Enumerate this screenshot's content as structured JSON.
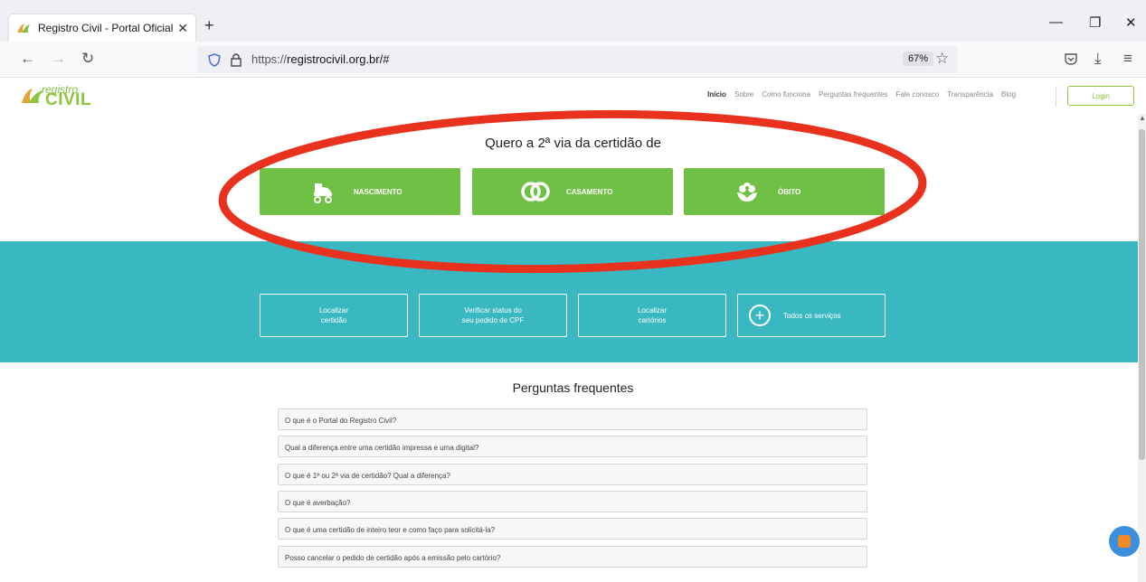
{
  "browser": {
    "tab_title": "Registro Civil - Portal Oficial",
    "tab_close": "✕",
    "new_tab": "+",
    "url_scheme": "https://",
    "url_rest": "registrocivil.org.br/#",
    "zoom": "67%"
  },
  "site": {
    "logo_small": "registro",
    "logo_big": "CIVIL",
    "menu": [
      "Início",
      "Sobre",
      "Como funciona",
      "Perguntas frequentes",
      "Fale conosco",
      "Transparência",
      "Blog"
    ],
    "login": "Login"
  },
  "hero": {
    "title": "Quero a 2ª via da certidão de",
    "buttons": [
      {
        "label": "NASCIMENTO",
        "icon": "stroller-icon"
      },
      {
        "label": "CASAMENTO",
        "icon": "rings-icon"
      },
      {
        "label": "ÓBITO",
        "icon": "flower-icon"
      }
    ]
  },
  "services": [
    {
      "label": "Localizar\ncertidão"
    },
    {
      "label": "Verificar status do\nseu pedido de CPF"
    },
    {
      "label": "Localizar\ncartórios"
    },
    {
      "label": "Todos os serviços",
      "icon": "plus-circle-icon"
    }
  ],
  "faq": {
    "title": "Perguntas frequentes",
    "items": [
      "O que é o Portal do Registro Civil?",
      "Qual a diferença entre uma certidão impressa e uma digital?",
      "O que é 1ª ou 2ª via de certidão? Qual a diferença?",
      "O que é averbação?",
      "O que é uma certidão de inteiro teor e como faço para solicitá-la?",
      "Posso cancelar o pedido de certidão após a emissão pelo cartório?"
    ]
  },
  "colors": {
    "green": "#71c046",
    "teal": "#3ab8c2",
    "annotation_red": "#e8321e"
  }
}
